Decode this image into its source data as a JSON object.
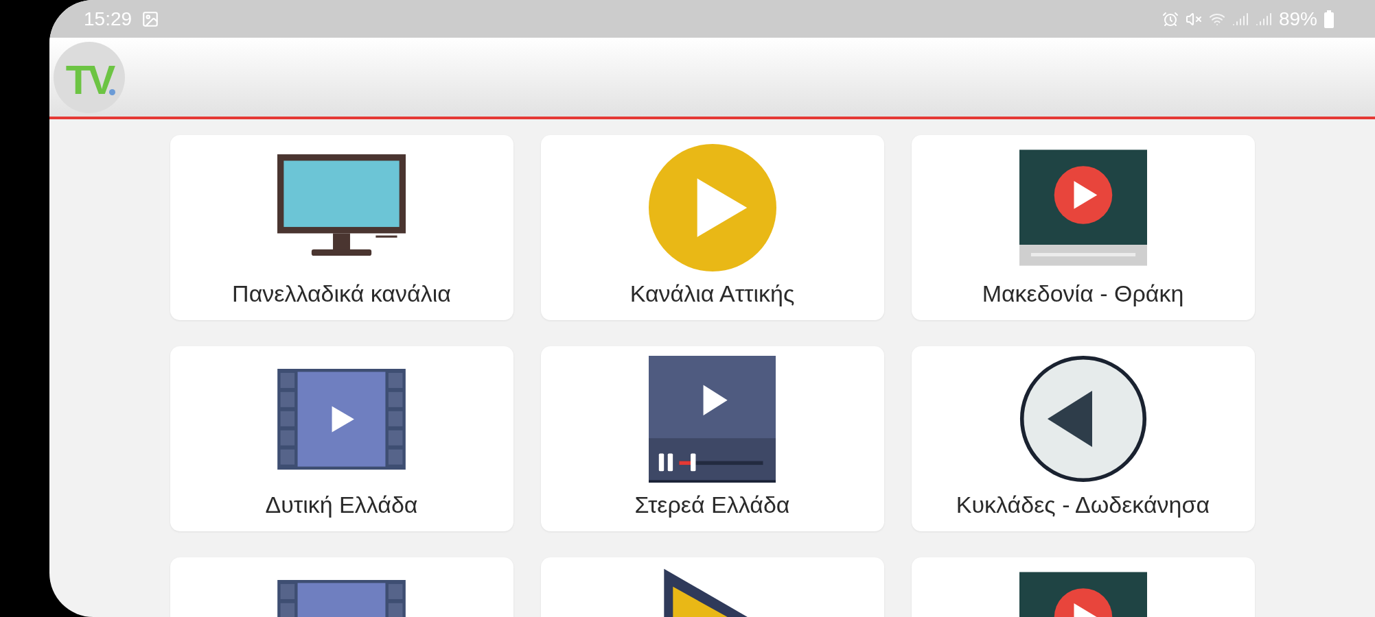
{
  "status_bar": {
    "time": "15:29",
    "battery": "89%"
  },
  "app_bar": {
    "logo": "TV"
  },
  "tiles": [
    {
      "label": "Πανελλαδικά κανάλια",
      "kind": "monitor"
    },
    {
      "label": "Κανάλια Αττικής",
      "kind": "play-circle"
    },
    {
      "label": "Μακεδονία - Θράκη",
      "kind": "video"
    },
    {
      "label": "Δυτική Ελλάδα",
      "kind": "film"
    },
    {
      "label": "Στερεά Ελλάδα",
      "kind": "player"
    },
    {
      "label": "Κυκλάδες - Δωδεκάνησα",
      "kind": "back"
    },
    {
      "kind": "film"
    },
    {
      "kind": "triangle"
    },
    {
      "kind": "video"
    }
  ]
}
